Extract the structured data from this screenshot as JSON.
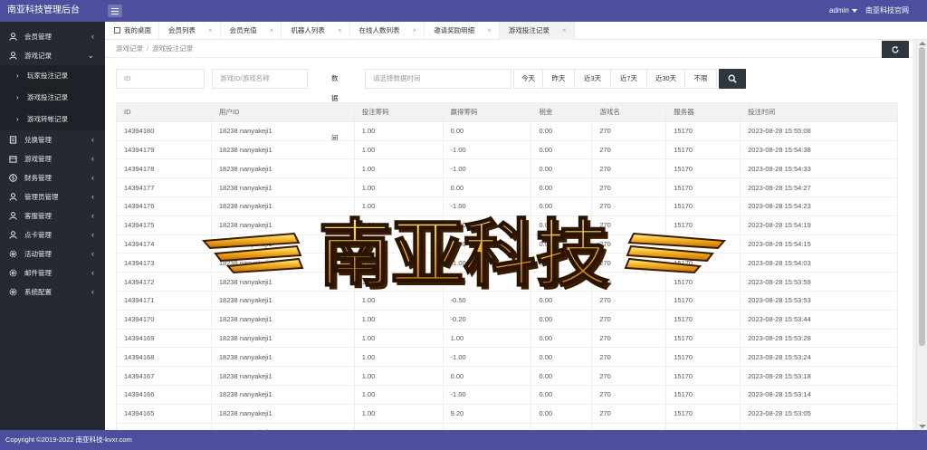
{
  "header": {
    "title": "南亚科技管理后台",
    "user": "admin",
    "site_link": "南亚科技官网"
  },
  "sidebar": {
    "items": [
      {
        "label": "会员管理",
        "icon": "user-icon"
      },
      {
        "label": "游戏记录",
        "icon": "user-icon",
        "expanded": true,
        "children": [
          "玩家投注记录",
          "游戏投注记录",
          "游戏转帐记录"
        ]
      },
      {
        "label": "兑换管理",
        "icon": "file-icon"
      },
      {
        "label": "游戏管理",
        "icon": "calendar-icon"
      },
      {
        "label": "财务管理",
        "icon": "dollar-icon"
      },
      {
        "label": "管理员管理",
        "icon": "user-icon"
      },
      {
        "label": "客服管理",
        "icon": "user-icon"
      },
      {
        "label": "点卡管理",
        "icon": "user-icon"
      },
      {
        "label": "活动管理",
        "icon": "gear-icon"
      },
      {
        "label": "邮件管理",
        "icon": "gear-icon"
      },
      {
        "label": "系统配置",
        "icon": "gear-icon"
      }
    ]
  },
  "tabs": [
    {
      "label": "我的桌面"
    },
    {
      "label": "会员列表"
    },
    {
      "label": "会员充值"
    },
    {
      "label": "机器人列表"
    },
    {
      "label": "在线人数列表"
    },
    {
      "label": "邀请奖励明细"
    },
    {
      "label": "游戏投注记录",
      "active": true
    }
  ],
  "breadcrumb": [
    "游戏记录",
    "游戏投注记录"
  ],
  "filters": {
    "id_placeholder": "ID",
    "game_placeholder": "游戏ID/游戏名称",
    "time_label": "数据时间",
    "time_placeholder": "请选择数据时间",
    "quick": [
      "今天",
      "昨天",
      "近3天",
      "近7天",
      "近30天",
      "不限"
    ]
  },
  "table": {
    "columns": [
      "ID",
      "用户ID",
      "投注筹码",
      "赢得筹码",
      "税金",
      "游戏名",
      "服务器",
      "投注时间"
    ],
    "rows": [
      [
        "14394180",
        "18238 nanyakeji1",
        "1.00",
        "0.00",
        "0.00",
        "270",
        "15170",
        "2023-08-28 15:55:08"
      ],
      [
        "14394179",
        "18238 nanyakeji1",
        "1.00",
        "-1.00",
        "0.00",
        "270",
        "15170",
        "2023-08-28 15:54:38"
      ],
      [
        "14394178",
        "18238 nanyakeji1",
        "1.00",
        "-1.00",
        "0.00",
        "270",
        "15170",
        "2023-08-28 15:54:33"
      ],
      [
        "14394177",
        "18238 nanyakeji1",
        "1.00",
        "0.00",
        "0.00",
        "270",
        "15170",
        "2023-08-28 15:54:27"
      ],
      [
        "14394176",
        "18238 nanyakeji1",
        "1.00",
        "-1.00",
        "0.00",
        "270",
        "15170",
        "2023-08-28 15:54:23"
      ],
      [
        "14394175",
        "18238 nanyakeji1",
        "1.00",
        "-1.00",
        "0.00",
        "270",
        "15170",
        "2023-08-28 15:54:19"
      ],
      [
        "14394174",
        "18238 nanyakeji1",
        "1.00",
        "-1.00",
        "0.00",
        "270",
        "15170",
        "2023-08-28 15:54:15"
      ],
      [
        "14394173",
        "18238 nanyakeji1",
        "1.00",
        "-1.00",
        "0.00",
        "270",
        "15170",
        "2023-08-28 15:54:03"
      ],
      [
        "14394172",
        "18238 nanyakeji1",
        "1.00",
        "-1.00",
        "0.00",
        "270",
        "15170",
        "2023-08-28 15:53:59"
      ],
      [
        "14394171",
        "18238 nanyakeji1",
        "1.00",
        "-0.50",
        "0.00",
        "270",
        "15170",
        "2023-08-28 15:53:53"
      ],
      [
        "14394170",
        "18238 nanyakeji1",
        "1.00",
        "-0.20",
        "0.00",
        "270",
        "15170",
        "2023-08-28 15:53:44"
      ],
      [
        "14394169",
        "18238 nanyakeji1",
        "1.00",
        "1.00",
        "0.00",
        "270",
        "15170",
        "2023-08-28 15:53:28"
      ],
      [
        "14394168",
        "18238 nanyakeji1",
        "1.00",
        "-1.00",
        "0.00",
        "270",
        "15170",
        "2023-08-28 15:53:24"
      ],
      [
        "14394167",
        "18238 nanyakeji1",
        "1.00",
        "0.00",
        "0.00",
        "270",
        "15170",
        "2023-08-28 15:53:18"
      ],
      [
        "14394166",
        "18238 nanyakeji1",
        "1.00",
        "-1.00",
        "0.00",
        "270",
        "15170",
        "2023-08-28 15:53:14"
      ],
      [
        "14394165",
        "18238 nanyakeji1",
        "1.00",
        "9.20",
        "0.00",
        "270",
        "15170",
        "2023-08-28 15:53:05"
      ],
      [
        "14394164",
        "18238 nanyakeji1",
        "1.00",
        "-1.00",
        "0.00",
        "270",
        "15170",
        "2023-08-28 15:53:00"
      ]
    ]
  },
  "footer": {
    "text": "Copyright ©2019-2022 南亚科技-kvxr.com"
  },
  "watermark": {
    "text": "南亚科技"
  },
  "colors": {
    "header_bg": "#4b4f9e",
    "sidebar_bg": "#252a32",
    "button_dark": "#2f363f",
    "watermark_gold": "#f0a010"
  }
}
